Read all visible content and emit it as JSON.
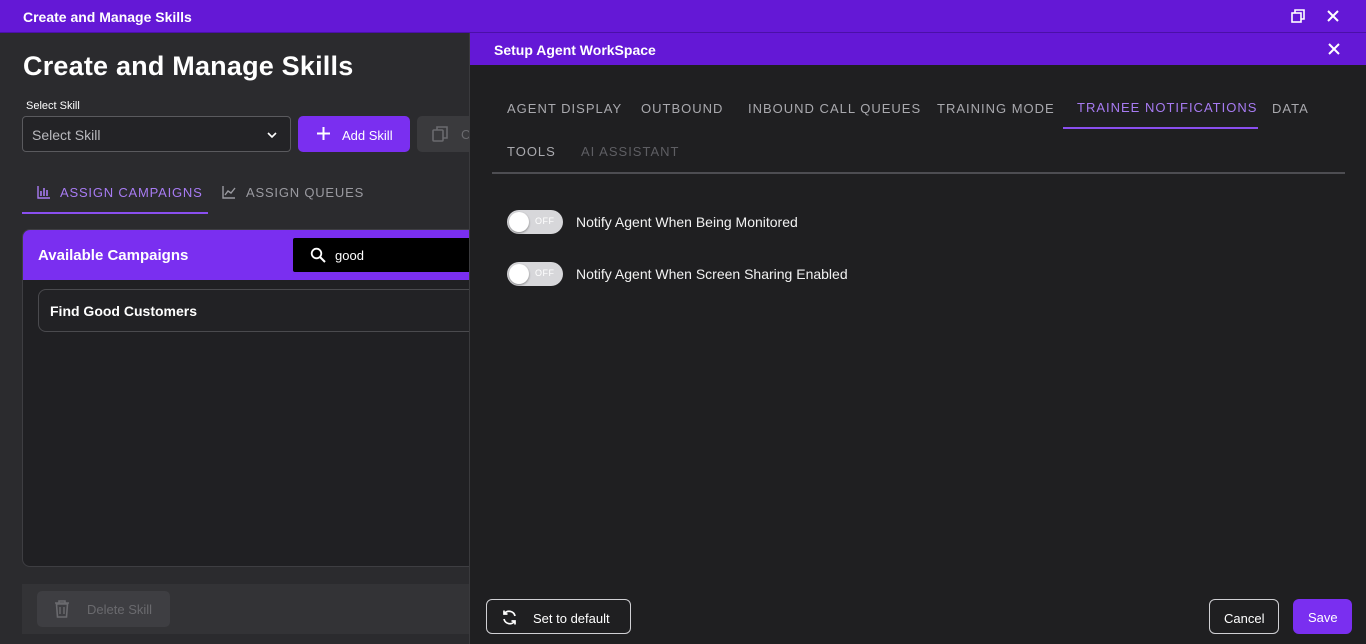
{
  "window": {
    "title": "Create and Manage Skills"
  },
  "left": {
    "page_title": "Create and Manage Skills",
    "select_skill_label": "Select Skill",
    "select_skill_placeholder": "Select Skill",
    "add_skill_label": "Add Skill",
    "copy_label": "C",
    "tabs": [
      {
        "label": "ASSIGN CAMPAIGNS",
        "icon": "bar-chart-icon",
        "active": true
      },
      {
        "label": "ASSIGN QUEUES",
        "icon": "line-chart-icon",
        "active": false
      }
    ],
    "campaigns_header": "Available Campaigns",
    "search_value": "good",
    "campaigns": [
      "Find Good Customers"
    ],
    "delete_skill_label": "Delete Skill"
  },
  "modal": {
    "title": "Setup Agent WorkSpace",
    "tabs": [
      {
        "label": "AGENT DISPLAY",
        "state": "inactive"
      },
      {
        "label": "OUTBOUND",
        "state": "inactive"
      },
      {
        "label": "INBOUND CALL QUEUES",
        "state": "inactive"
      },
      {
        "label": "TRAINING MODE",
        "state": "inactive"
      },
      {
        "label": "TRAINEE NOTIFICATIONS",
        "state": "active"
      },
      {
        "label": "DATA",
        "state": "inactive"
      },
      {
        "label": "TOOLS",
        "state": "inactive"
      },
      {
        "label": "AI ASSISTANT",
        "state": "disabled"
      }
    ],
    "options": [
      {
        "label": "Notify Agent When Being Monitored",
        "toggle": "OFF"
      },
      {
        "label": "Notify Agent When Screen Sharing Enabled",
        "toggle": "OFF"
      }
    ],
    "set_default_label": "Set to default",
    "cancel_label": "Cancel",
    "save_label": "Save"
  },
  "colors": {
    "accent": "#7a2ff0",
    "titlebar": "#6418d6",
    "active_tab": "#a77bf2"
  }
}
